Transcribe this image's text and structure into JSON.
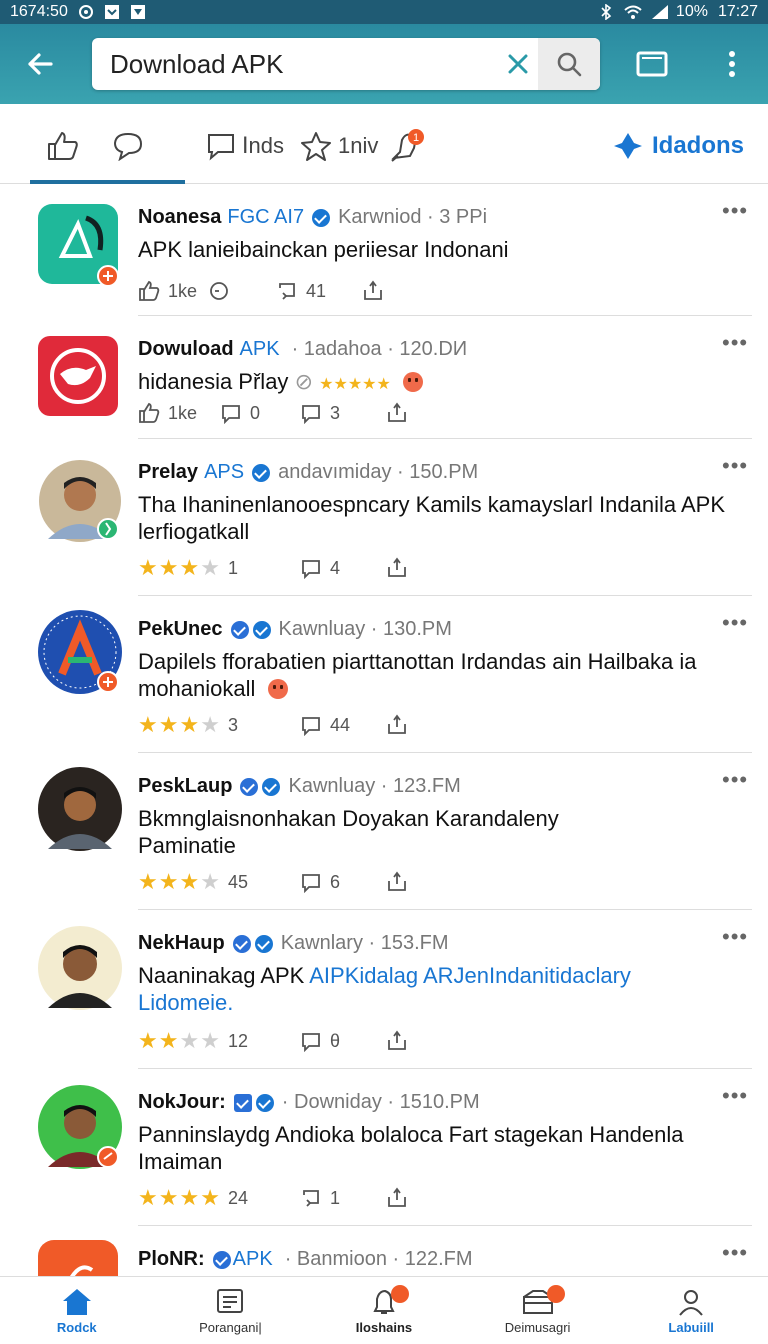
{
  "status_bar": {
    "time_left": "1674:50",
    "battery": "10%",
    "time_right": "17:27"
  },
  "app_bar": {
    "search": {
      "value": "Download APK",
      "placeholder": ""
    }
  },
  "filters": {
    "items": [
      {
        "label": ""
      },
      {
        "label": ""
      },
      {
        "label": "Ⅰnds"
      },
      {
        "label": "1niv"
      },
      {
        "label": ""
      }
    ],
    "notification_count": "1",
    "action_label": "Idadons"
  },
  "posts": [
    {
      "name": "Noanesa",
      "tag": "FGC AI7",
      "meta": "Karwniod · 3 PPi",
      "body": "APK lanieibainckan periiesar Indonani",
      "likes": "1ke",
      "comments": "",
      "reposts": "41"
    },
    {
      "name": "Dowuload",
      "tag": "APK",
      "meta": "· 1adahoa · 120.DИ",
      "body": "hidanesia Přlay",
      "likes": "1ke",
      "comments": "0",
      "reposts": "3"
    },
    {
      "name": "Prelay",
      "tag": "APS",
      "meta": "andavımiday · 150.PM",
      "body": "Tha Ihaninenlanooespncary Kamils kamayslarl Indanila APK lerfiogatkall",
      "rating": 3,
      "count": "1",
      "reposts": "4"
    },
    {
      "name": "PekUnec",
      "tag": "",
      "meta": "Kawnluay · 130.PM",
      "body": "Dapilels fforabatien piarttanottan Irdandas ain Hailbaka ia mohaniokall",
      "rating": 2.5,
      "count": "3",
      "reposts": "44"
    },
    {
      "name": "PeskLaup",
      "tag": "",
      "meta": "Kawnluay · 123.FM",
      "body": "Bkmnglaisnonhakan Doyakan Karandaleny Paminatie",
      "rating": 3,
      "count": "45",
      "reposts": "6"
    },
    {
      "name": "NekHaup",
      "tag": "",
      "meta": "Kawnlary · 153.FM",
      "body": "Naaninakag APK",
      "body_link": "AIPKidalag ARJenIndanitidaclary Lidomeie.",
      "rating": 2,
      "count": "12",
      "reposts": "θ"
    },
    {
      "name": "NokJour:",
      "tag": "",
      "meta": "· Downiday · 1510.PM",
      "body": "Panninslaydg Andioka bolaloca Fart stagekan Handenla Imaiman",
      "rating": 4,
      "count": "24",
      "reposts": "1"
    },
    {
      "name": "PloNR:",
      "tag": "APK",
      "meta": "· Banmioon · 122.FM",
      "body": ""
    }
  ],
  "bottom_nav": [
    {
      "label": "Rodck"
    },
    {
      "label": "Porangani|"
    },
    {
      "label": "Iloshains",
      "badge": ""
    },
    {
      "label": "Deimusagri",
      "badge": ""
    },
    {
      "label": "Labuiill"
    }
  ],
  "colors": {
    "primary": "#2a8aa0",
    "accent": "#1976d2",
    "star": "#f3b41c",
    "badge": "#f05a28"
  }
}
